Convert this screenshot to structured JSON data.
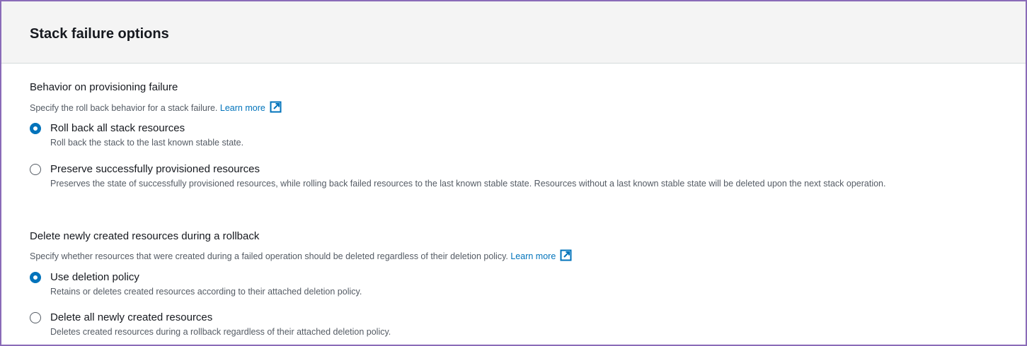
{
  "panel": {
    "title": "Stack failure options"
  },
  "provisioning": {
    "label": "Behavior on provisioning failure",
    "description": "Specify the roll back behavior for a stack failure.",
    "learn_more": "Learn more",
    "options": [
      {
        "label": "Roll back all stack resources",
        "description": "Roll back the stack to the last known stable state.",
        "selected": true
      },
      {
        "label": "Preserve successfully provisioned resources",
        "description": "Preserves the state of successfully provisioned resources, while rolling back failed resources to the last known stable state. Resources without a last known stable state will be deleted upon the next stack operation.",
        "selected": false
      }
    ]
  },
  "rollback_delete": {
    "label": "Delete newly created resources during a rollback",
    "description": "Specify whether resources that were created during a failed operation should be deleted regardless of their deletion policy.",
    "learn_more": "Learn more",
    "options": [
      {
        "label": "Use deletion policy",
        "description": "Retains or deletes created resources according to their attached deletion policy.",
        "selected": true
      },
      {
        "label": "Delete all newly created resources",
        "description": "Deletes created resources during a rollback regardless of their attached deletion policy.",
        "selected": false
      }
    ]
  },
  "colors": {
    "accent": "#0073bb",
    "border": "#8a6bb8",
    "header_bg": "#f4f4f4"
  },
  "icons": {
    "external_link": "external-link-icon"
  }
}
